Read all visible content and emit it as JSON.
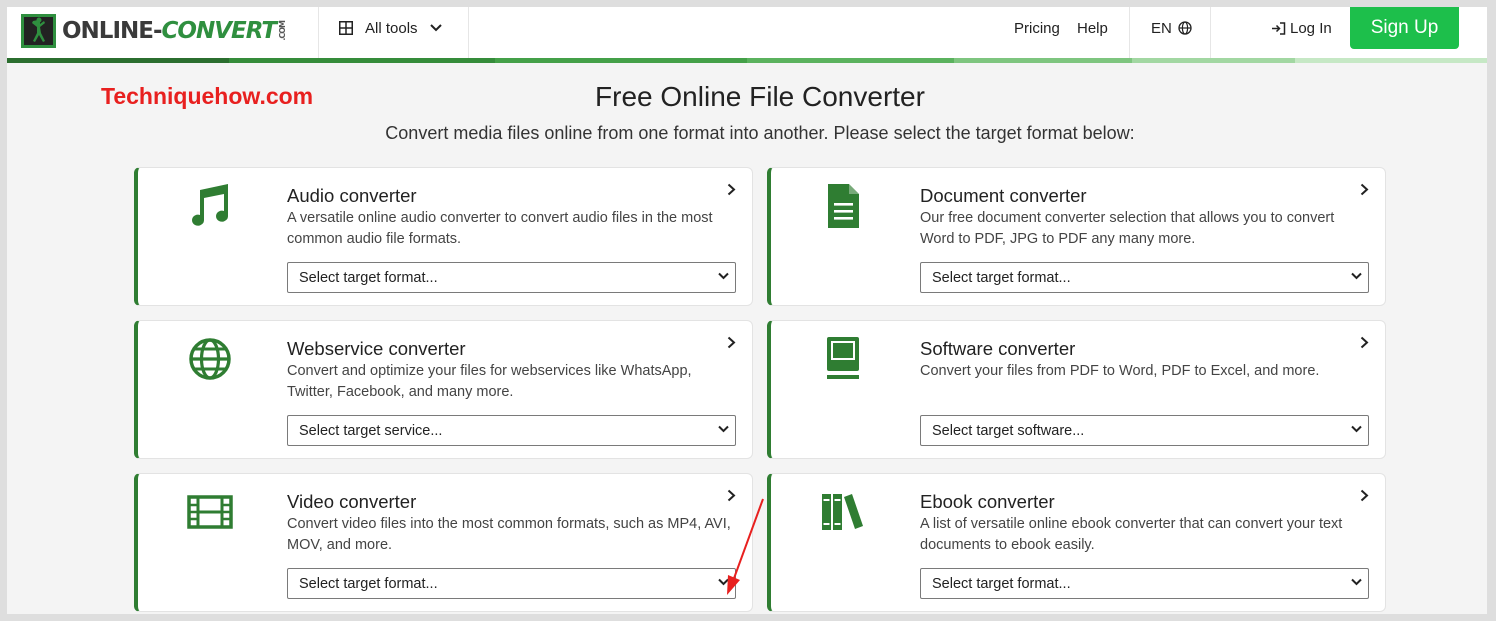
{
  "header": {
    "logo_main": "ONLINE-",
    "logo_accent": "CONVERT",
    "logo_suffix": ".COM",
    "all_tools": "All tools",
    "pricing": "Pricing",
    "help": "Help",
    "language": "EN",
    "login": "Log In",
    "signup": "Sign Up"
  },
  "watermark": "Techniquehow.com",
  "hero": {
    "title": "Free Online File Converter",
    "subtitle": "Convert media files online from one format into another. Please select the target format below:"
  },
  "converters": [
    {
      "title": "Audio converter",
      "desc": "A versatile online audio converter to convert audio files in the most common audio file formats.",
      "select": "Select target format...",
      "icon": "music-note-icon"
    },
    {
      "title": "Document converter",
      "desc": "Our free document converter selection that allows you to convert Word to PDF, JPG to PDF any many more.",
      "select": "Select target format...",
      "icon": "document-icon"
    },
    {
      "title": "Webservice converter",
      "desc": "Convert and optimize your files for webservices like WhatsApp, Twitter, Facebook, and many more.",
      "select": "Select target service...",
      "icon": "globe-icon"
    },
    {
      "title": "Software converter",
      "desc": "Convert your files from PDF to Word, PDF to Excel, and more.",
      "select": "Select target software...",
      "icon": "computer-icon"
    },
    {
      "title": "Video converter",
      "desc": "Convert video files into the most common formats, such as MP4, AVI, MOV, and more.",
      "select": "Select target format...",
      "icon": "film-icon"
    },
    {
      "title": "Ebook converter",
      "desc": "A list of versatile online ebook converter that can convert your text documents to ebook easily.",
      "select": "Select target format...",
      "icon": "books-icon"
    }
  ],
  "colors": {
    "accent_green": "#2f7d32",
    "signup_green": "#1dbf4b",
    "watermark_red": "#e8201f",
    "annotation_arrow": "#e8201f"
  }
}
